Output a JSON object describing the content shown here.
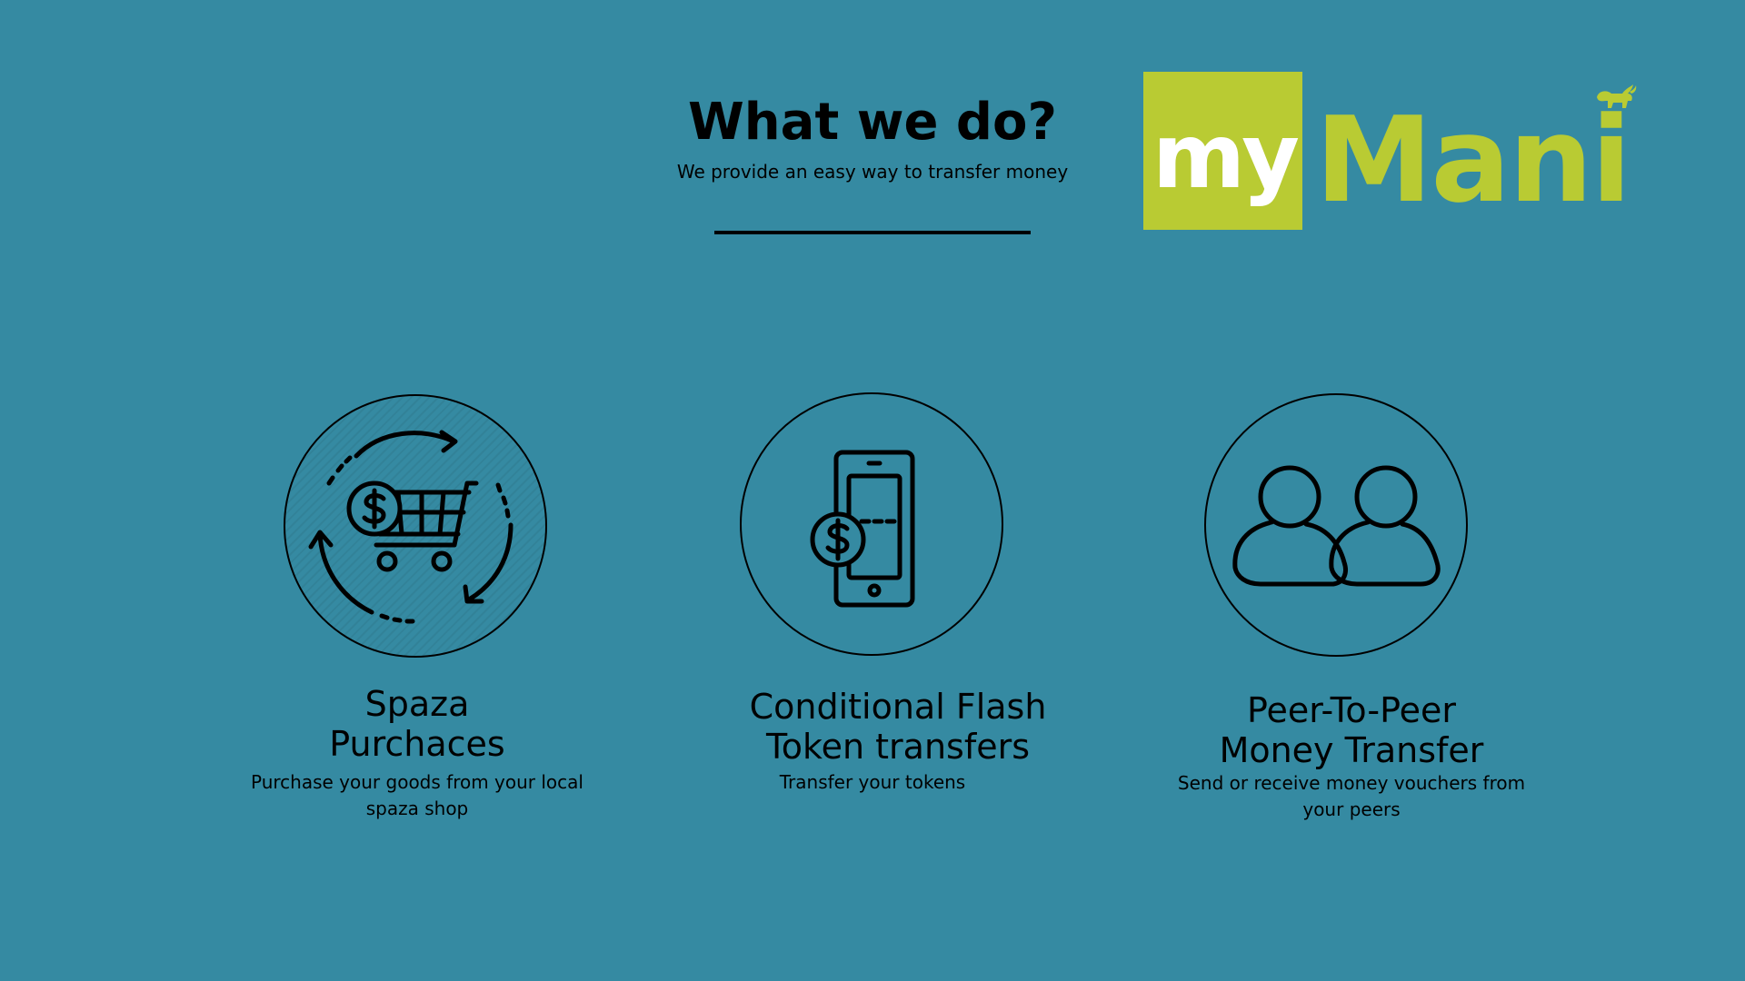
{
  "header": {
    "title": "What we do?",
    "subtitle": "We provide an easy way to transfer money"
  },
  "logo": {
    "part1": "my",
    "part2": "Mani",
    "icon": "bull-icon"
  },
  "colors": {
    "background": "#358aa2",
    "brand_green": "#b9cb33",
    "text": "#000000",
    "logo_text_white": "#ffffff"
  },
  "services": [
    {
      "title_line1": "Spaza",
      "title_line2": "Purchaces",
      "desc_line1": "Purchase your goods from your local",
      "desc_line2": "spaza shop",
      "icon": "shopping-cart-cycle-icon"
    },
    {
      "title_line1": "Conditional Flash",
      "title_line2": "Token transfers",
      "desc_line1": "Transfer your tokens",
      "icon": "mobile-payment-icon"
    },
    {
      "title_line1": "Peer-To-Peer",
      "title_line2": "Money Transfer",
      "desc_line1": "Send or receive money vouchers from",
      "desc_line2": "your peers",
      "icon": "users-icon"
    }
  ]
}
